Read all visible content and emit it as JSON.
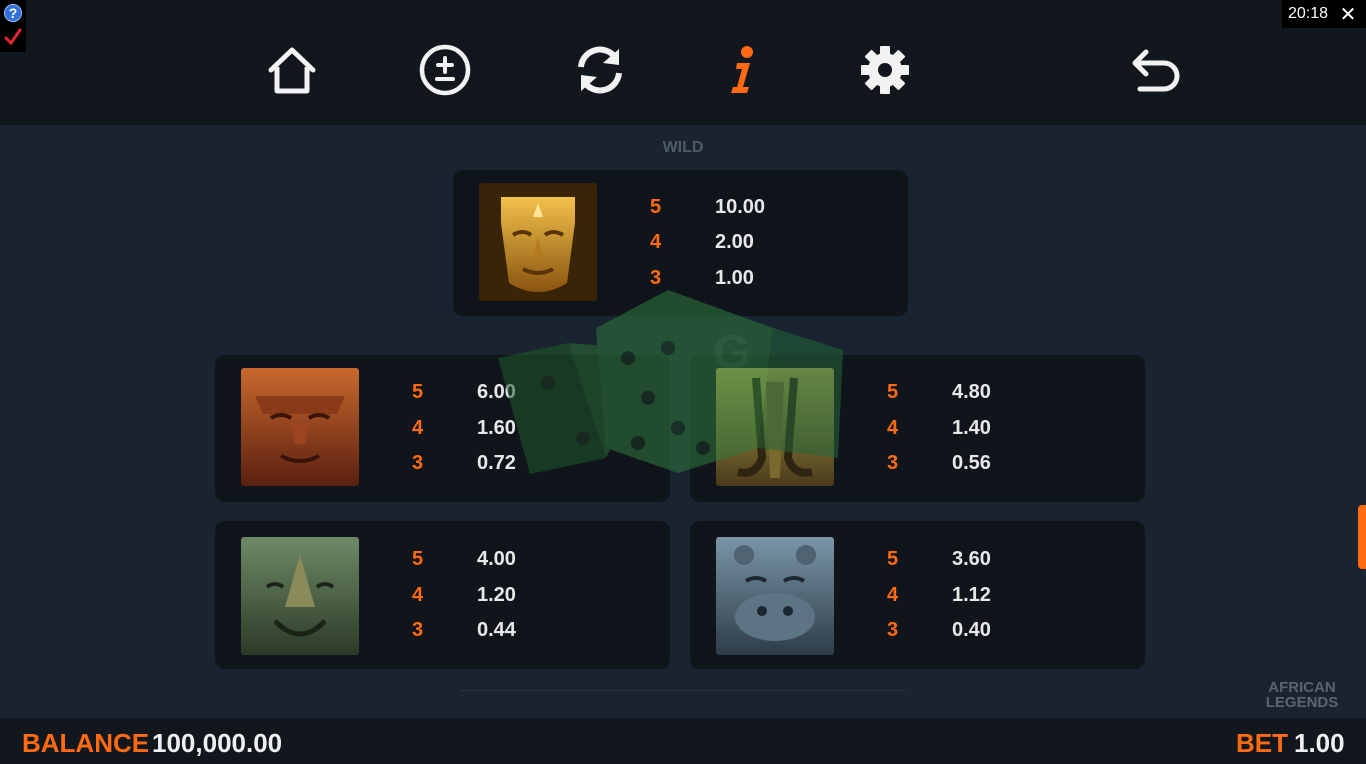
{
  "clock": "20:18",
  "toolbar": {
    "buttons": [
      {
        "name": "home-icon"
      },
      {
        "name": "bet-adjust-icon"
      },
      {
        "name": "autoplay-icon"
      },
      {
        "name": "info-icon",
        "active": true
      },
      {
        "name": "gear-icon"
      },
      {
        "name": "back-arrow-icon"
      }
    ],
    "active_color": "#ff6a13",
    "icon_color": "#f2f2f2"
  },
  "section_heading": "WILD",
  "paytable": [
    {
      "symbol": "golden-mask",
      "pays": [
        {
          "count": "5",
          "value": "10.00"
        },
        {
          "count": "4",
          "value": "2.00"
        },
        {
          "count": "3",
          "value": "1.00"
        }
      ]
    },
    {
      "symbol": "lion-mask",
      "pays": [
        {
          "count": "5",
          "value": "6.00"
        },
        {
          "count": "4",
          "value": "1.60"
        },
        {
          "count": "3",
          "value": "0.72"
        }
      ]
    },
    {
      "symbol": "elephant-mask",
      "pays": [
        {
          "count": "5",
          "value": "4.80"
        },
        {
          "count": "4",
          "value": "1.40"
        },
        {
          "count": "3",
          "value": "0.56"
        }
      ]
    },
    {
      "symbol": "rhino-mask",
      "pays": [
        {
          "count": "5",
          "value": "4.00"
        },
        {
          "count": "4",
          "value": "1.20"
        },
        {
          "count": "3",
          "value": "0.44"
        }
      ]
    },
    {
      "symbol": "hippo-mask",
      "pays": [
        {
          "count": "5",
          "value": "3.60"
        },
        {
          "count": "4",
          "value": "1.12"
        },
        {
          "count": "3",
          "value": "0.40"
        }
      ]
    }
  ],
  "logo": {
    "line1": "AFRICAN",
    "line2": "LEGENDS"
  },
  "footer": {
    "balance_label": "BALANCE",
    "balance_value": "100,000.00",
    "bet_label": "BET",
    "bet_value": "1.00"
  },
  "accent_color": "#ff6a13"
}
